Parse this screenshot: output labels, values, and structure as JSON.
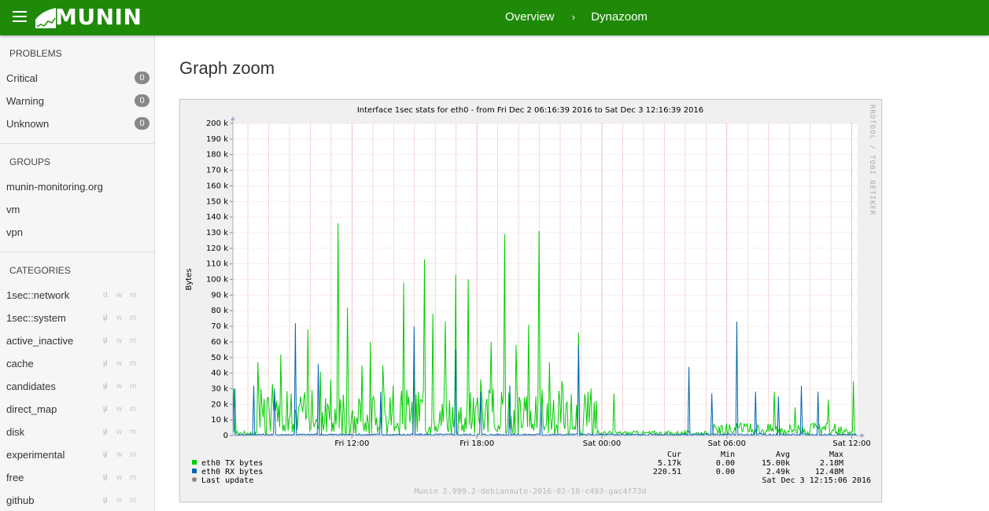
{
  "header": {
    "logo_text": "MUNIN",
    "breadcrumb": [
      "Overview",
      "Dynazoom"
    ],
    "separator": "›"
  },
  "sidebar": {
    "problems_title": "PROBLEMS",
    "problems": [
      {
        "label": "Critical",
        "count": "0"
      },
      {
        "label": "Warning",
        "count": "0"
      },
      {
        "label": "Unknown",
        "count": "0"
      }
    ],
    "groups_title": "GROUPS",
    "groups": [
      "munin-monitoring.org",
      "vm",
      "vpn"
    ],
    "categories_title": "CATEGORIES",
    "period_labels": [
      "d",
      "w",
      "m",
      "y"
    ],
    "categories": [
      "1sec::network",
      "1sec::system",
      "active_inactive",
      "cache",
      "candidates",
      "direct_map",
      "disk",
      "experimental",
      "free",
      "github"
    ]
  },
  "main": {
    "title": "Graph zoom"
  },
  "chart_data": {
    "type": "line",
    "title": "Interface 1sec stats for eth0 - from Fri Dec  2 06:16:39 2016 to Sat Dec  3 12:16:39 2016",
    "ylabel": "Bytes",
    "ylim": [
      0,
      200000
    ],
    "y_ticks": [
      "0",
      "10 k",
      "20 k",
      "30 k",
      "40 k",
      "50 k",
      "60 k",
      "70 k",
      "80 k",
      "90 k",
      "100 k",
      "110 k",
      "120 k",
      "130 k",
      "140 k",
      "150 k",
      "160 k",
      "170 k",
      "180 k",
      "190 k",
      "200 k"
    ],
    "x_ticks": [
      {
        "label": "Fri 12:00",
        "hour": 5.72
      },
      {
        "label": "Fri 18:00",
        "hour": 11.72
      },
      {
        "label": "Sat 00:00",
        "hour": 17.72
      },
      {
        "label": "Sat 06:00",
        "hour": 23.72
      },
      {
        "label": "Sat 12:00",
        "hour": 29.72
      }
    ],
    "x_range_hours": [
      0,
      30
    ],
    "x_unit": "hours since Fri Dec 2 06:16:39 2016",
    "grid": true,
    "watermark": "RRDTOOL / TOBI OETIKER",
    "series": [
      {
        "name": "eth0 TX bytes",
        "color": "#00cc00",
        "peaks": [
          {
            "hour": 0.1,
            "value": 30000
          },
          {
            "hour": 1.2,
            "value": 47000
          },
          {
            "hour": 1.9,
            "value": 33000
          },
          {
            "hour": 2.3,
            "value": 52000
          },
          {
            "hour": 2.8,
            "value": 27000
          },
          {
            "hour": 3.6,
            "value": 68000
          },
          {
            "hour": 4.2,
            "value": 41000
          },
          {
            "hour": 4.7,
            "value": 36000
          },
          {
            "hour": 5.05,
            "value": 136000
          },
          {
            "hour": 5.5,
            "value": 82000
          },
          {
            "hour": 6.2,
            "value": 45000
          },
          {
            "hour": 6.6,
            "value": 60000
          },
          {
            "hour": 7.2,
            "value": 45000
          },
          {
            "hour": 7.7,
            "value": 32000
          },
          {
            "hour": 8.2,
            "value": 98000
          },
          {
            "hour": 8.7,
            "value": 43000
          },
          {
            "hour": 9.2,
            "value": 113000
          },
          {
            "hour": 9.6,
            "value": 78000
          },
          {
            "hour": 10.2,
            "value": 73000
          },
          {
            "hour": 10.7,
            "value": 103000
          },
          {
            "hour": 11.3,
            "value": 100000
          },
          {
            "hour": 11.9,
            "value": 36000
          },
          {
            "hour": 12.4,
            "value": 60000
          },
          {
            "hour": 13.05,
            "value": 129000
          },
          {
            "hour": 13.6,
            "value": 58000
          },
          {
            "hour": 14.2,
            "value": 71000
          },
          {
            "hour": 14.7,
            "value": 131000
          },
          {
            "hour": 15.2,
            "value": 47000
          },
          {
            "hour": 15.8,
            "value": 35000
          },
          {
            "hour": 16.6,
            "value": 66000
          },
          {
            "hour": 17.2,
            "value": 30000
          },
          {
            "hour": 18.3,
            "value": 27000
          },
          {
            "hour": 24.4,
            "value": 8000
          },
          {
            "hour": 26.0,
            "value": 28000
          },
          {
            "hour": 27.0,
            "value": 18000
          },
          {
            "hour": 28.6,
            "value": 23000
          },
          {
            "hour": 29.8,
            "value": 35000
          }
        ]
      },
      {
        "name": "eth0 RX bytes",
        "color": "#0066b3",
        "peaks": [
          {
            "hour": 0.05,
            "value": 30000
          },
          {
            "hour": 1.0,
            "value": 32000
          },
          {
            "hour": 2.0,
            "value": 30000
          },
          {
            "hour": 3.0,
            "value": 72000
          },
          {
            "hour": 4.1,
            "value": 46000
          },
          {
            "hour": 7.1,
            "value": 28000
          },
          {
            "hour": 8.7,
            "value": 70000
          },
          {
            "hour": 10.7,
            "value": 55000
          },
          {
            "hour": 11.9,
            "value": 28000
          },
          {
            "hour": 13.3,
            "value": 32000
          },
          {
            "hour": 14.8,
            "value": 20000
          },
          {
            "hour": 16.6,
            "value": 58000
          },
          {
            "hour": 21.9,
            "value": 44000
          },
          {
            "hour": 23.0,
            "value": 27000
          },
          {
            "hour": 24.2,
            "value": 73000
          },
          {
            "hour": 25.1,
            "value": 28000
          },
          {
            "hour": 26.2,
            "value": 25000
          },
          {
            "hour": 27.3,
            "value": 32000
          },
          {
            "hour": 28.1,
            "value": 28000
          }
        ]
      }
    ],
    "legend": {
      "headers": [
        "Cur",
        "Min",
        "Avg",
        "Max"
      ],
      "rows": [
        {
          "name": "eth0 TX bytes",
          "color": "#00cc00",
          "cur": "5.17k",
          "min": "0.00",
          "avg": "15.00k",
          "max": "2.18M"
        },
        {
          "name": "eth0 RX bytes",
          "color": "#0066b3",
          "cur": "220.51",
          "min": "0.00",
          "avg": "2.49k",
          "max": "12.48M"
        }
      ],
      "last_update_label": "Last update",
      "last_update_value": "Sat Dec  3 12:15:06 2016",
      "last_update_color": "#888888"
    },
    "footer": "Munin 2.999.2-debianauto-2016-02-10-c493-gac4f73d"
  }
}
